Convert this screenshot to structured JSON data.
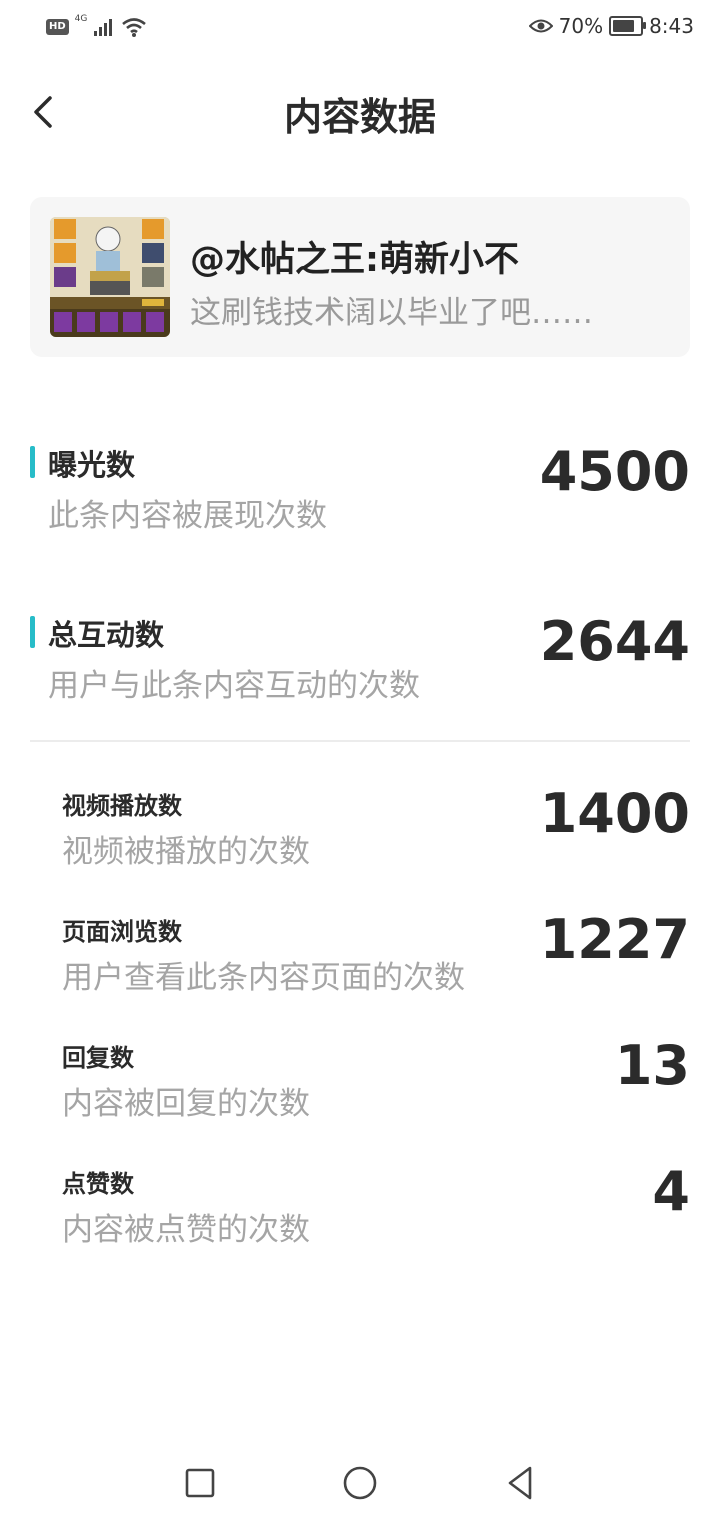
{
  "status_bar": {
    "hd_label": "HD",
    "network_label": "4G",
    "battery_percent_text": "70%",
    "battery_level": 0.7,
    "time": "8:43",
    "icons": [
      "hd-icon",
      "signal-icon",
      "wifi-icon",
      "eye-icon",
      "battery-icon"
    ]
  },
  "header": {
    "title": "内容数据",
    "back_icon": "chevron-left-icon"
  },
  "post": {
    "author": "@水帖之王:萌新小不",
    "excerpt": "这刷钱技术阔以毕业了吧……"
  },
  "metrics_primary": [
    {
      "title": "曝光数",
      "desc": "此条内容被展现次数",
      "value": "4500"
    },
    {
      "title": "总互动数",
      "desc": "用户与此条内容互动的次数",
      "value": "2644"
    }
  ],
  "metrics_secondary": [
    {
      "title": "视频播放数",
      "desc": "视频被播放的次数",
      "value": "1400"
    },
    {
      "title": "页面浏览数",
      "desc": "用户查看此条内容页面的次数",
      "value": "1227"
    },
    {
      "title": "回复数",
      "desc": "内容被回复的次数",
      "value": "13"
    },
    {
      "title": "点赞数",
      "desc": "内容被点赞的次数",
      "value": "4"
    }
  ],
  "colors": {
    "accent": "#27bcc8",
    "card_bg": "#f6f6f6",
    "text_primary": "#2b2b2b",
    "text_secondary": "#a5a5a5"
  },
  "nav_bar": {
    "icons": [
      "square-icon",
      "circle-home-icon",
      "triangle-back-icon"
    ]
  }
}
